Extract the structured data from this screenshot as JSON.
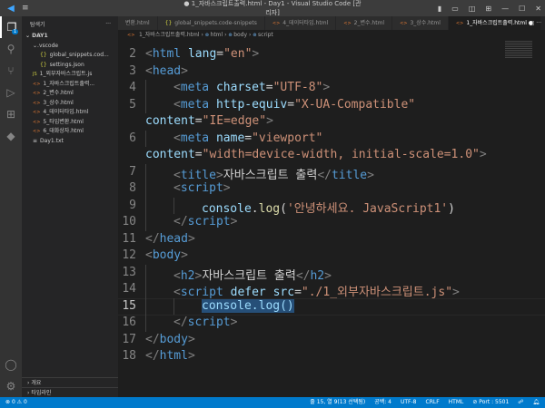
{
  "window": {
    "title": "● 1_자바스크립트출력.html - Day1 - Visual Studio Code [관리자]"
  },
  "sidebar": {
    "title": "탐색기",
    "more": "···",
    "root": "DAY1",
    "items": [
      {
        "label": ".vscode",
        "icon": "chevron-down-icon",
        "kind": "folder"
      },
      {
        "label": "global_snippets.cod...",
        "icon": "json-icon",
        "kind": "json"
      },
      {
        "label": "settings.json",
        "icon": "json-icon",
        "kind": "json"
      },
      {
        "label": "1_외부자바스크립트.js",
        "icon": "js-icon",
        "kind": "js"
      },
      {
        "label": "1_자바스크립트출력...",
        "icon": "html-icon",
        "kind": "html"
      },
      {
        "label": "2_변수.html",
        "icon": "html-icon",
        "kind": "html"
      },
      {
        "label": "3_상수.html",
        "icon": "html-icon",
        "kind": "html"
      },
      {
        "label": "4_데이터타입.html",
        "icon": "html-icon",
        "kind": "html"
      },
      {
        "label": "5_타입변환.html",
        "icon": "html-icon",
        "kind": "html"
      },
      {
        "label": "6_대화상자.html",
        "icon": "html-icon",
        "kind": "html"
      },
      {
        "label": "Day1.txt",
        "icon": "txt-icon",
        "kind": "txt"
      }
    ],
    "outline": "개요",
    "timeline": "타임라인"
  },
  "tabs": [
    {
      "label": "변환.html"
    },
    {
      "label": "global_snippets.code-snippets"
    },
    {
      "label": "4_데이터타입.html"
    },
    {
      "label": "2_변수.html"
    },
    {
      "label": "3_상수.html"
    },
    {
      "label": "1_자바스크립트출력.html",
      "active": true
    }
  ],
  "breadcrumb": [
    "1_자바스크립트출력.html",
    "html",
    "body",
    "script"
  ],
  "editor": {
    "current_line": "15",
    "lines": [
      {
        "n": "2",
        "c": [
          [
            "p",
            "<"
          ],
          [
            "t",
            "html"
          ],
          [
            "a",
            " lang"
          ],
          [
            "x",
            "="
          ],
          [
            "s",
            "\"en\""
          ],
          [
            "p",
            ">"
          ]
        ]
      },
      {
        "n": "3",
        "c": [
          [
            "p",
            "<"
          ],
          [
            "t",
            "head"
          ],
          [
            "p",
            ">"
          ]
        ]
      },
      {
        "n": "4",
        "i": 1,
        "c": [
          [
            "p",
            "<"
          ],
          [
            "t",
            "meta"
          ],
          [
            "a",
            " charset"
          ],
          [
            "x",
            "="
          ],
          [
            "s",
            "\"UTF-8\""
          ],
          [
            "p",
            ">"
          ]
        ]
      },
      {
        "n": "5",
        "i": 1,
        "c": [
          [
            "p",
            "<"
          ],
          [
            "t",
            "meta"
          ],
          [
            "a",
            " http-equiv"
          ],
          [
            "x",
            "="
          ],
          [
            "s",
            "\"X-UA-Compatible\""
          ]
        ]
      },
      {
        "n": "",
        "c": [
          [
            "a",
            "content"
          ],
          [
            "x",
            "="
          ],
          [
            "s",
            "\"IE=edge\""
          ],
          [
            "p",
            ">"
          ]
        ]
      },
      {
        "n": "6",
        "i": 1,
        "c": [
          [
            "p",
            "<"
          ],
          [
            "t",
            "meta"
          ],
          [
            "a",
            " name"
          ],
          [
            "x",
            "="
          ],
          [
            "s",
            "\"viewport\""
          ]
        ]
      },
      {
        "n": "",
        "c": [
          [
            "a",
            "content"
          ],
          [
            "x",
            "="
          ],
          [
            "s",
            "\"width=device-width, initial-scale=1.0\""
          ],
          [
            "p",
            ">"
          ]
        ]
      },
      {
        "n": "7",
        "i": 1,
        "c": [
          [
            "p",
            "<"
          ],
          [
            "t",
            "title"
          ],
          [
            "p",
            ">"
          ],
          [
            "x",
            "자바스크립트 출력"
          ],
          [
            "p",
            "</"
          ],
          [
            "t",
            "title"
          ],
          [
            "p",
            ">"
          ]
        ]
      },
      {
        "n": "8",
        "i": 1,
        "c": [
          [
            "p",
            "<"
          ],
          [
            "t",
            "script"
          ],
          [
            "p",
            ">"
          ]
        ]
      },
      {
        "n": "9",
        "i": 2,
        "c": [
          [
            "a",
            "console"
          ],
          [
            "x",
            "."
          ],
          [
            "f",
            "log"
          ],
          [
            "x",
            "("
          ],
          [
            "s",
            "'안녕하세요. JavaScript1'"
          ],
          [
            "x",
            ")"
          ]
        ]
      },
      {
        "n": "10",
        "i": 1,
        "c": [
          [
            "p",
            "</"
          ],
          [
            "t",
            "script"
          ],
          [
            "p",
            ">"
          ]
        ]
      },
      {
        "n": "11",
        "c": [
          [
            "p",
            "</"
          ],
          [
            "t",
            "head"
          ],
          [
            "p",
            ">"
          ]
        ]
      },
      {
        "n": "12",
        "c": [
          [
            "p",
            "<"
          ],
          [
            "t",
            "body"
          ],
          [
            "p",
            ">"
          ]
        ]
      },
      {
        "n": "13",
        "i": 1,
        "c": [
          [
            "p",
            "<"
          ],
          [
            "t",
            "h2"
          ],
          [
            "p",
            ">"
          ],
          [
            "x",
            "자바스크립트 출력"
          ],
          [
            "p",
            "</"
          ],
          [
            "t",
            "h2"
          ],
          [
            "p",
            ">"
          ]
        ]
      },
      {
        "n": "14",
        "i": 1,
        "c": [
          [
            "p",
            "<"
          ],
          [
            "t",
            "script"
          ],
          [
            "a",
            " defer src"
          ],
          [
            "x",
            "="
          ],
          [
            "s",
            "\"./1_외부자바스크립트.js\""
          ],
          [
            "p",
            ">"
          ]
        ]
      },
      {
        "n": "15",
        "i": 2,
        "c": [
          [
            "hl",
            "console.log()"
          ]
        ]
      },
      {
        "n": "16",
        "i": 1,
        "c": [
          [
            "p",
            "</"
          ],
          [
            "t",
            "script"
          ],
          [
            "p",
            ">"
          ]
        ]
      },
      {
        "n": "17",
        "c": [
          [
            "p",
            "</"
          ],
          [
            "t",
            "body"
          ],
          [
            "p",
            ">"
          ]
        ]
      },
      {
        "n": "18",
        "c": [
          [
            "p",
            "</"
          ],
          [
            "t",
            "html"
          ],
          [
            "p",
            ">"
          ]
        ]
      }
    ]
  },
  "status": {
    "errors": "0",
    "warnings": "0",
    "position": "줄 15, 열 9(13 선택됨)",
    "indent": "공백: 4",
    "encoding": "UTF-8",
    "eol": "CRLF",
    "language": "HTML",
    "port": "Port : 5501"
  },
  "badge": "1"
}
